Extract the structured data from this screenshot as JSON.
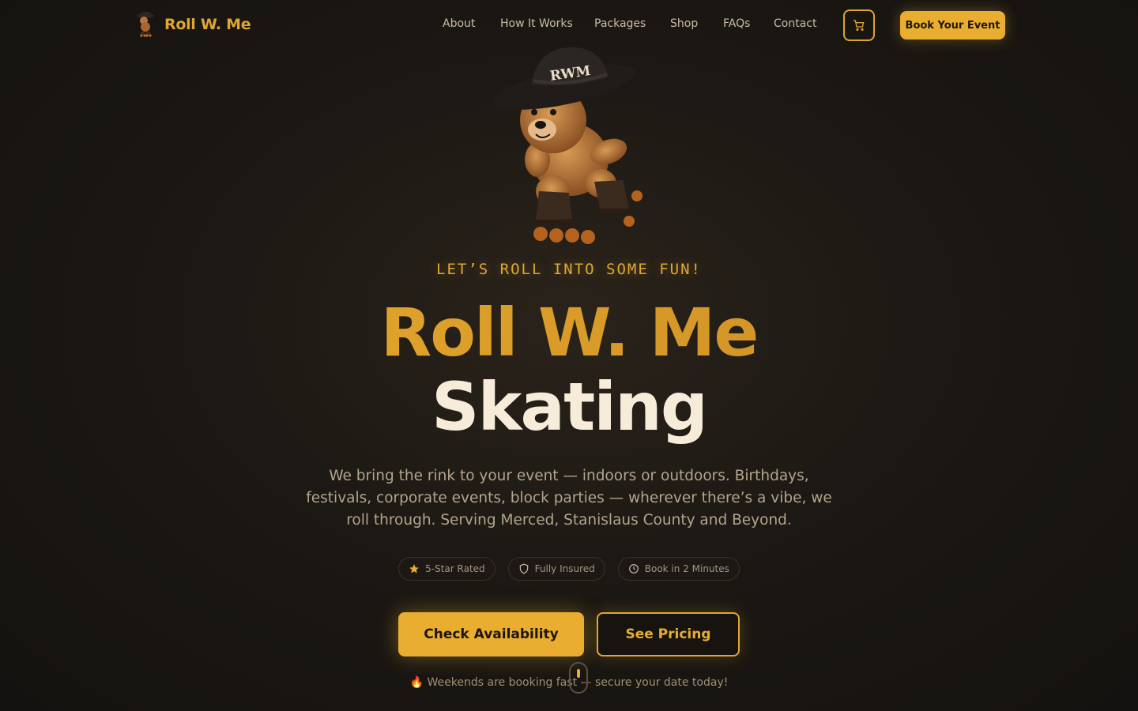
{
  "brand": {
    "name": "Roll W. Me",
    "logo_icon": "bear-skater-logo-icon"
  },
  "nav": {
    "links": [
      "About",
      "How It Works",
      "Packages",
      "Shop",
      "FAQs",
      "Contact"
    ],
    "cart_icon": "cart-icon",
    "book_label": "Book Your Event"
  },
  "hero": {
    "mascot_icon": "bear-cowboy-skater-illustration",
    "mascot_hat_text": "RWM",
    "kicker": "LET’S ROLL INTO SOME FUN!",
    "title_line1": "Roll W. Me",
    "title_line2": "Skating",
    "description": "We bring the rink to your event — indoors or outdoors. Birthdays, festivals, corporate events, block parties — wherever there’s a vibe, we roll through. Serving Merced, Stanislaus County and Beyond.",
    "badges": [
      {
        "icon": "star-icon",
        "label": "5-Star Rated"
      },
      {
        "icon": "shield-icon",
        "label": "Fully Insured"
      },
      {
        "icon": "clock-icon",
        "label": "Book in 2 Minutes"
      }
    ],
    "cta_primary": "Check Availability",
    "cta_secondary": "See Pricing",
    "urgency_emoji": "🔥",
    "urgency_text": "Weekends are booking fast — secure your date today!"
  },
  "colors": {
    "accent": "#e9ae30",
    "background": "#1c1813",
    "text_light": "#f6ecd9",
    "text_muted": "#b3a58e"
  }
}
